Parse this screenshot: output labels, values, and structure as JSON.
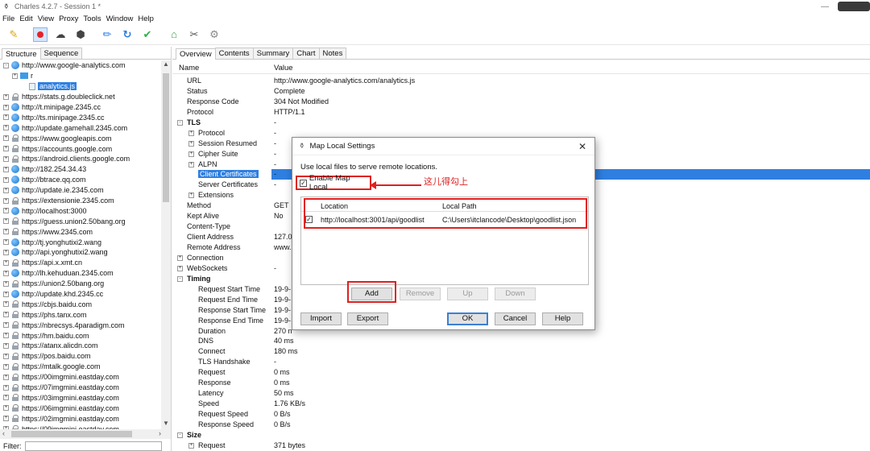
{
  "window": {
    "title": "Charles 4.2.7 - Session 1 *"
  },
  "menu": [
    "File",
    "Edit",
    "View",
    "Proxy",
    "Tools",
    "Window",
    "Help"
  ],
  "left": {
    "tabs": [
      "Structure",
      "Sequence"
    ],
    "active_tab": "Structure",
    "tree": [
      {
        "label": "http://www.google-analytics.com",
        "icon": "globe",
        "exp": "-",
        "indent": 0
      },
      {
        "label": "r",
        "icon": "folder",
        "exp": "+",
        "indent": 1
      },
      {
        "label": "analytics.js",
        "icon": "file",
        "exp": "",
        "indent": 2,
        "selected": true
      },
      {
        "label": "https://stats.g.doubleclick.net",
        "icon": "lock",
        "exp": "+",
        "indent": 0
      },
      {
        "label": "http://t.minipage.2345.cc",
        "icon": "globe",
        "exp": "+",
        "indent": 0
      },
      {
        "label": "http://ts.minipage.2345.cc",
        "icon": "globe",
        "exp": "+",
        "indent": 0
      },
      {
        "label": "http://update.gamehall.2345.com",
        "icon": "globe",
        "exp": "+",
        "indent": 0
      },
      {
        "label": "https://www.googleapis.com",
        "icon": "lock",
        "exp": "+",
        "indent": 0
      },
      {
        "label": "https://accounts.google.com",
        "icon": "lock",
        "exp": "+",
        "indent": 0
      },
      {
        "label": "https://android.clients.google.com",
        "icon": "lock",
        "exp": "+",
        "indent": 0
      },
      {
        "label": "http://182.254.34.43",
        "icon": "globe",
        "exp": "+",
        "indent": 0
      },
      {
        "label": "http://btrace.qq.com",
        "icon": "globe",
        "exp": "+",
        "indent": 0
      },
      {
        "label": "http://update.ie.2345.com",
        "icon": "globe",
        "exp": "+",
        "indent": 0
      },
      {
        "label": "https://extensionie.2345.com",
        "icon": "lock",
        "exp": "+",
        "indent": 0
      },
      {
        "label": "http://localhost:3000",
        "icon": "globe",
        "exp": "+",
        "indent": 0
      },
      {
        "label": "https://guess.union2.50bang.org",
        "icon": "lock",
        "exp": "+",
        "indent": 0
      },
      {
        "label": "https://www.2345.com",
        "icon": "lock",
        "exp": "+",
        "indent": 0
      },
      {
        "label": "http://tj.yonghutixi2.wang",
        "icon": "globe",
        "exp": "+",
        "indent": 0
      },
      {
        "label": "http://api.yonghutixi2.wang",
        "icon": "globe",
        "exp": "+",
        "indent": 0
      },
      {
        "label": "https://api.x.xmt.cn",
        "icon": "lock",
        "exp": "+",
        "indent": 0
      },
      {
        "label": "http://lh.kehuduan.2345.com",
        "icon": "globe",
        "exp": "+",
        "indent": 0
      },
      {
        "label": "https://union2.50bang.org",
        "icon": "lock",
        "exp": "+",
        "indent": 0
      },
      {
        "label": "http://update.khd.2345.cc",
        "icon": "globe",
        "exp": "+",
        "indent": 0
      },
      {
        "label": "https://cbjs.baidu.com",
        "icon": "lock",
        "exp": "+",
        "indent": 0
      },
      {
        "label": "https://phs.tanx.com",
        "icon": "lock",
        "exp": "+",
        "indent": 0
      },
      {
        "label": "https://nbrecsys.4paradigm.com",
        "icon": "lock",
        "exp": "+",
        "indent": 0
      },
      {
        "label": "https://hm.baidu.com",
        "icon": "lock",
        "exp": "+",
        "indent": 0
      },
      {
        "label": "https://atanx.alicdn.com",
        "icon": "lock",
        "exp": "+",
        "indent": 0
      },
      {
        "label": "https://pos.baidu.com",
        "icon": "lock",
        "exp": "+",
        "indent": 0
      },
      {
        "label": "https://mtalk.google.com",
        "icon": "lock",
        "exp": "+",
        "indent": 0
      },
      {
        "label": "https://00imgmini.eastday.com",
        "icon": "lock",
        "exp": "+",
        "indent": 0
      },
      {
        "label": "https://07imgmini.eastday.com",
        "icon": "lock",
        "exp": "+",
        "indent": 0
      },
      {
        "label": "https://03imgmini.eastday.com",
        "icon": "lock",
        "exp": "+",
        "indent": 0
      },
      {
        "label": "https://06imgmini.eastday.com",
        "icon": "lock",
        "exp": "+",
        "indent": 0
      },
      {
        "label": "https://02imgmini.eastday.com",
        "icon": "lock",
        "exp": "+",
        "indent": 0
      },
      {
        "label": "https://09imgmini.eastday.com",
        "icon": "lock",
        "exp": "+",
        "indent": 0
      }
    ],
    "filter_label": "Filter:",
    "filter_value": ""
  },
  "right": {
    "tabs": [
      "Overview",
      "Contents",
      "Summary",
      "Chart",
      "Notes"
    ],
    "active_tab": "Overview",
    "col_name": "Name",
    "col_value": "Value",
    "rows": [
      {
        "k": "URL",
        "v": "http://www.google-analytics.com/analytics.js",
        "level": 1
      },
      {
        "k": "Status",
        "v": "Complete",
        "level": 1
      },
      {
        "k": "Response Code",
        "v": "304 Not Modified",
        "level": 1
      },
      {
        "k": "Protocol",
        "v": "HTTP/1.1",
        "level": 1
      },
      {
        "k": "TLS",
        "v": "-",
        "level": 0,
        "exp": "-",
        "bold": true
      },
      {
        "k": "Protocol",
        "v": "-",
        "level": 1,
        "exp": "+"
      },
      {
        "k": "Session Resumed",
        "v": "-",
        "level": 1,
        "exp": "+"
      },
      {
        "k": "Cipher Suite",
        "v": "-",
        "level": 1,
        "exp": "+"
      },
      {
        "k": "ALPN",
        "v": "-",
        "level": 1,
        "exp": "+"
      },
      {
        "k": "Client Certificates",
        "v": "-",
        "level": 2,
        "selected": true
      },
      {
        "k": "Server Certificates",
        "v": "-",
        "level": 2
      },
      {
        "k": "Extensions",
        "v": "",
        "level": 1,
        "exp": "+"
      },
      {
        "k": "Method",
        "v": "GET",
        "level": 1
      },
      {
        "k": "Kept Alive",
        "v": "No",
        "level": 1
      },
      {
        "k": "Content-Type",
        "v": "",
        "level": 1
      },
      {
        "k": "Client Address",
        "v": "127.0",
        "level": 1
      },
      {
        "k": "Remote Address",
        "v": "www.",
        "level": 1
      },
      {
        "k": "Connection",
        "v": "",
        "level": 0,
        "exp": "+"
      },
      {
        "k": "WebSockets",
        "v": "-",
        "level": 0,
        "exp": "+"
      },
      {
        "k": "Timing",
        "v": "",
        "level": 0,
        "exp": "-",
        "bold": true
      },
      {
        "k": "Request Start Time",
        "v": "19-9-",
        "level": 2
      },
      {
        "k": "Request End Time",
        "v": "19-9-",
        "level": 2
      },
      {
        "k": "Response Start Time",
        "v": "19-9-",
        "level": 2
      },
      {
        "k": "Response End Time",
        "v": "19-9-",
        "level": 2
      },
      {
        "k": "Duration",
        "v": "270 n",
        "level": 2
      },
      {
        "k": "DNS",
        "v": "40 ms",
        "level": 2
      },
      {
        "k": "Connect",
        "v": "180 ms",
        "level": 2
      },
      {
        "k": "TLS Handshake",
        "v": "-",
        "level": 2
      },
      {
        "k": "Request",
        "v": "0 ms",
        "level": 2
      },
      {
        "k": "Response",
        "v": "0 ms",
        "level": 2
      },
      {
        "k": "Latency",
        "v": "50 ms",
        "level": 2
      },
      {
        "k": "Speed",
        "v": "1.76 KB/s",
        "level": 2
      },
      {
        "k": "Request Speed",
        "v": "0 B/s",
        "level": 2
      },
      {
        "k": "Response Speed",
        "v": "0 B/s",
        "level": 2
      },
      {
        "k": "Size",
        "v": "",
        "level": 0,
        "exp": "-",
        "bold": true
      },
      {
        "k": "Request",
        "v": "371 bytes",
        "level": 1,
        "exp": "+"
      }
    ]
  },
  "dialog": {
    "title": "Map Local Settings",
    "description": "Use local files to serve remote locations.",
    "enable_label": "Enable Map Local",
    "annotation": "这儿得勾上",
    "col_location": "Location",
    "col_local_path": "Local Path",
    "mapping": {
      "location": "http://localhost:3001/api/goodlist",
      "local_path": "C:\\Users\\itclancode\\Desktop\\goodlist.json"
    },
    "buttons": {
      "add": "Add",
      "remove": "Remove",
      "up": "Up",
      "down": "Down",
      "import": "Import",
      "export": "Export",
      "ok": "OK",
      "cancel": "Cancel",
      "help": "Help"
    },
    "annotation_color": "#e02020"
  }
}
